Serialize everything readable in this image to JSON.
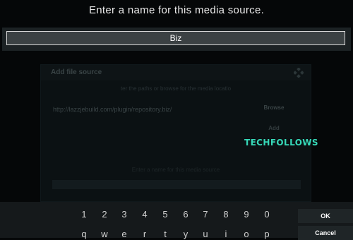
{
  "prompt": {
    "title": "Enter a name for this media source."
  },
  "name_input": {
    "value": "Biz"
  },
  "dialog": {
    "title": "Add file source",
    "hint": "ter the paths or browse for the media locatio",
    "url": "http://lazzjebuild.com/plugin/repository.biz/",
    "browse_label": "Browse",
    "add_label": "Add",
    "name_hint": "Enter a name for this media source"
  },
  "watermark": "TECHFOLLOWS",
  "keyboard": {
    "numbers": [
      "1",
      "2",
      "3",
      "4",
      "5",
      "6",
      "7",
      "8",
      "9",
      "0"
    ],
    "letters": [
      "q",
      "w",
      "e",
      "r",
      "t",
      "y",
      "u",
      "i",
      "o",
      "p"
    ],
    "ok_label": "OK",
    "cancel_label": "Cancel"
  },
  "colors": {
    "accent": "#36d8b8",
    "background": "#050708"
  }
}
